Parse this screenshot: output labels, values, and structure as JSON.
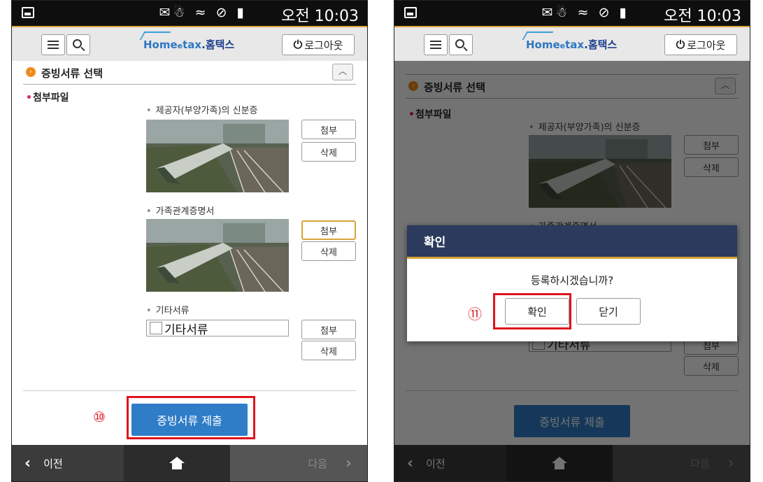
{
  "status_bar": {
    "icons_text": "✉☃ ≈ ⊘ ▮",
    "time": "오전 10:03"
  },
  "top_bar": {
    "logo_home": "Home",
    "logo_tax": "tax",
    "logo_suffix": "홈택스",
    "logout_label": "로그아웃"
  },
  "section": {
    "title": "증빙서류 선택"
  },
  "form": {
    "required_label": "첨부파일",
    "docs": [
      {
        "label": "제공자(부양가족)의 신분증",
        "attach": "첨부",
        "delete": "삭제"
      },
      {
        "label": "가족관계증명서",
        "attach": "첨부",
        "delete": "삭제"
      },
      {
        "label": "기타서류",
        "input_value": "기타서류",
        "attach": "첨부",
        "delete": "삭제"
      }
    ],
    "submit_label": "증빙서류 제출"
  },
  "nav": {
    "prev": "이전",
    "next": "다음"
  },
  "callouts": {
    "step10": "⑩",
    "step11": "⑪"
  },
  "dialog": {
    "title": "확인",
    "message": "등록하시겠습니까?",
    "ok_label": "확인",
    "close_label": "닫기"
  },
  "colors": {
    "accent": "#d9a43a",
    "submit_blue": "#2f7cc7",
    "dialog_header": "#2c3a5e",
    "highlight_red": "#e0141e",
    "required_star": "#e0245e"
  }
}
